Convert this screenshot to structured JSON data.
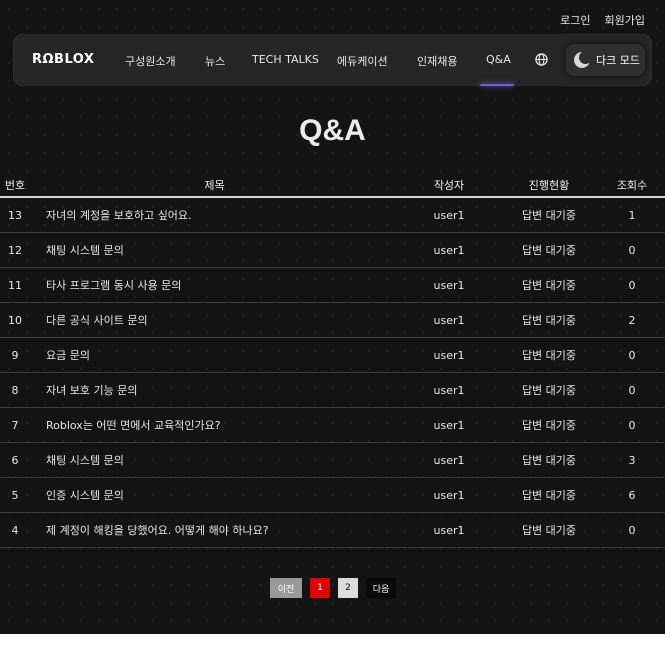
{
  "header": {
    "login": "로그인",
    "signup": "회원가입"
  },
  "nav": {
    "logo": "RΩBLOX",
    "items": [
      "구성원소개",
      "뉴스",
      "TECH TALKS",
      "에듀케이션",
      "인재채용",
      "Q&A"
    ],
    "dark_mode": "다크 모드",
    "icons": {
      "globe": "globe-icon",
      "moon": "moon-icon"
    },
    "accent_color": "#6f5fe0"
  },
  "page_title": "Q&A",
  "table": {
    "headers": {
      "num": "번호",
      "title": "제목",
      "author": "작성자",
      "status": "진행현황",
      "views": "조회수"
    },
    "rows": [
      {
        "num": "13",
        "title": "자녀의 계정을 보호하고 싶어요.",
        "author": "user1",
        "status": "답변 대기중",
        "views": "1"
      },
      {
        "num": "12",
        "title": "채팅 시스템 문의",
        "author": "user1",
        "status": "답변 대기중",
        "views": "0"
      },
      {
        "num": "11",
        "title": "타사 프로그램 동시 사용 문의",
        "author": "user1",
        "status": "답변 대기중",
        "views": "0"
      },
      {
        "num": "10",
        "title": "다른 공식 사이트 문의",
        "author": "user1",
        "status": "답변 대기중",
        "views": "2"
      },
      {
        "num": "9",
        "title": "요금 문의",
        "author": "user1",
        "status": "답변 대기중",
        "views": "0"
      },
      {
        "num": "8",
        "title": "자녀 보호 기능 문의",
        "author": "user1",
        "status": "답변 대기중",
        "views": "0"
      },
      {
        "num": "7",
        "title": "Roblox는 어떤 면에서 교육적인가요?",
        "author": "user1",
        "status": "답변 대기중",
        "views": "0"
      },
      {
        "num": "6",
        "title": "채팅 시스템 문의",
        "author": "user1",
        "status": "답변 대기중",
        "views": "3"
      },
      {
        "num": "5",
        "title": "인증 시스템 문의",
        "author": "user1",
        "status": "답변 대기중",
        "views": "6"
      },
      {
        "num": "4",
        "title": "제 계정이 해킹을 당했어요. 어떻게 해야 하나요?",
        "author": "user1",
        "status": "답변 대기중",
        "views": "0"
      }
    ]
  },
  "pagination": {
    "prev": "이전",
    "pages": [
      "1",
      "2"
    ],
    "next": "다음",
    "current": "1",
    "current_color": "#e00000"
  }
}
